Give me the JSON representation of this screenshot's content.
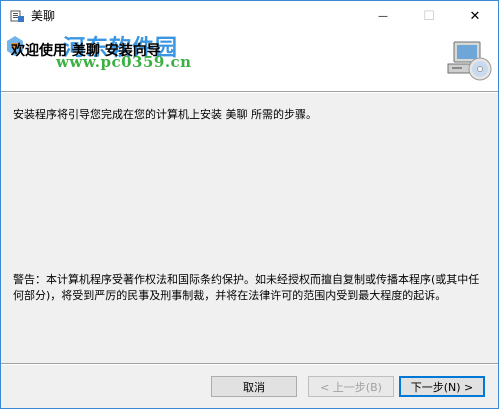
{
  "window": {
    "title": "美聊",
    "minimize_glyph": "—",
    "maximize_glyph": "☐",
    "close_glyph": "✕"
  },
  "banner": {
    "title": "欢迎使用 美聊 安装向导",
    "watermark_name": "河东软件园",
    "watermark_url": "www.pc0359.cn",
    "icon": "computer-cd-icon"
  },
  "content": {
    "intro": "安装程序将引导您完成在您的计算机上安装 美聊 所需的步骤。",
    "warning": "警告：本计算机程序受著作权法和国际条约保护。如未经授权而擅自复制或传播本程序(或其中任何部分)，将受到严厉的民事及刑事制裁，并将在法律许可的范围内受到最大程度的起诉。"
  },
  "buttons": {
    "cancel": "取消",
    "back": "< 上一步(B)",
    "next": "下一步(N) >"
  },
  "colors": {
    "frame_border": "#3a8ad6",
    "dialog_bg": "#f0f0f0",
    "focus_blue": "#0078d7",
    "watermark_blue": "#2a8ee0",
    "watermark_green": "#3cb043"
  }
}
